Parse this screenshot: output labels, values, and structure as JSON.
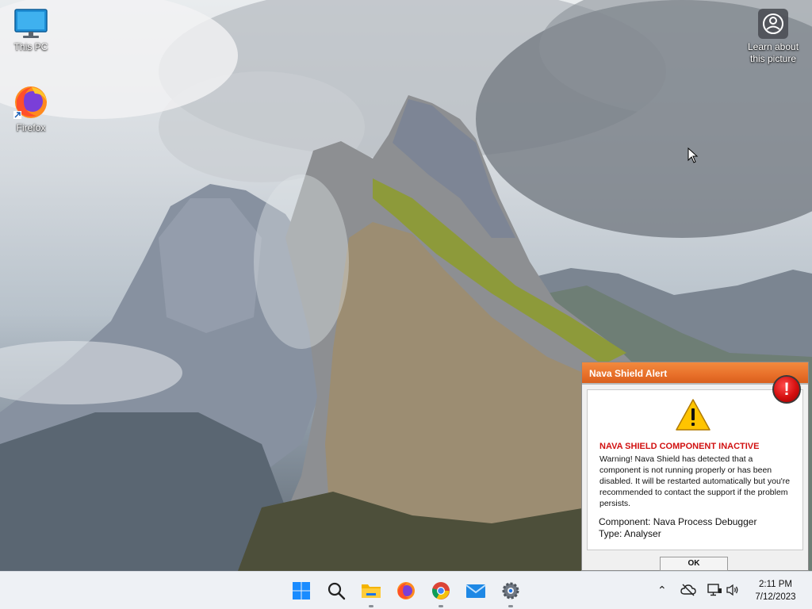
{
  "desktop": {
    "icons": [
      {
        "label": "This PC",
        "icon": "monitor-icon"
      },
      {
        "label": "Firefox",
        "icon": "firefox-icon"
      }
    ],
    "learn_about": {
      "line1": "Learn about",
      "line2": "this picture",
      "icon": "camera-circle-icon"
    }
  },
  "alert": {
    "title": "Nava Shield Alert",
    "badge": "!",
    "heading": "NAVA SHIELD COMPONENT INACTIVE",
    "message": "Warning! Nava Shield has detected that a component is not running properly or has been disabled. It will be restarted automatically but you're recommended to contact the support if the problem persists.",
    "component": "Component: Nava Process Debugger",
    "type": "Type: Analyser",
    "ok_label": "OK",
    "colors": {
      "titlebar": "#e8702a",
      "heading": "#d11111",
      "badge": "#d40f0f"
    }
  },
  "taskbar": {
    "apps": [
      "start-icon",
      "search-icon",
      "file-explorer-icon",
      "firefox-icon",
      "chrome-icon",
      "mail-icon",
      "settings-icon"
    ],
    "tray": [
      "chevron-up-icon",
      "cloud-off-icon",
      "network-icon",
      "volume-icon"
    ],
    "clock": {
      "time": "2:11 PM",
      "date": "7/12/2023"
    }
  }
}
